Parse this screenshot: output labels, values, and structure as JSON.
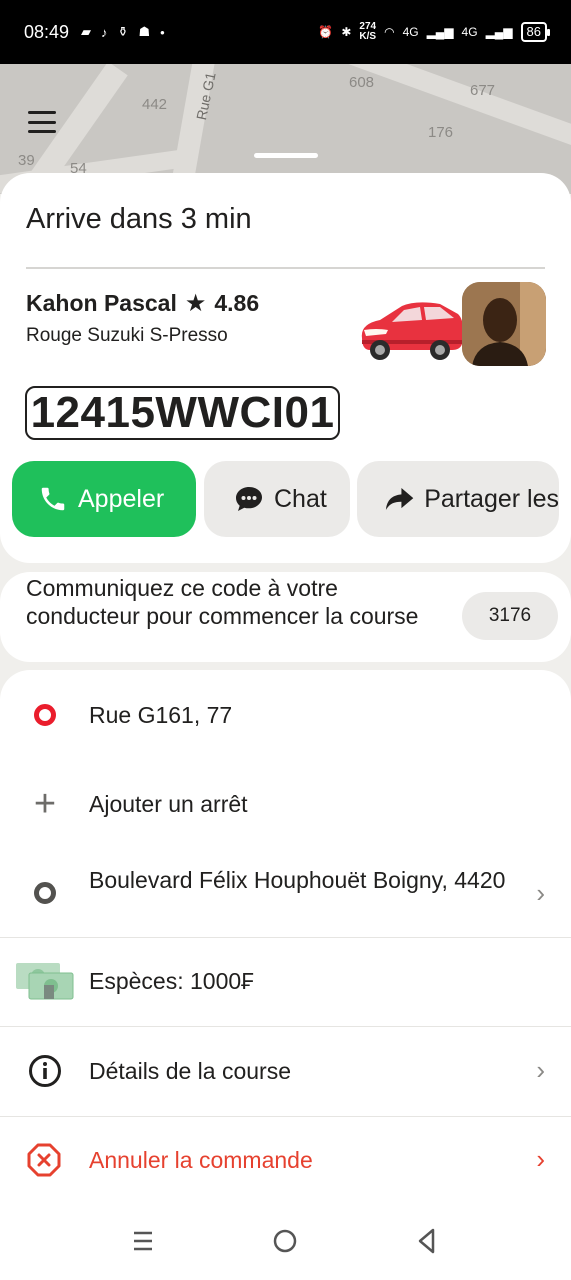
{
  "status_bar": {
    "time": "08:49",
    "net_speed_value": "274",
    "net_speed_unit": "K/S",
    "network_1": "4G",
    "network_2": "4G",
    "battery": "86"
  },
  "map": {
    "road_label": "Rue G1",
    "house_numbers": [
      "442",
      "608",
      "677",
      "176",
      "39",
      "54"
    ]
  },
  "trip": {
    "arrival_status": "Arrive dans 3 min"
  },
  "driver": {
    "name": "Kahon Pascal",
    "rating": "4.86",
    "car_description": "Rouge Suzuki S-Presso",
    "plate": "12415WWCI01",
    "car_color": "#e8323f"
  },
  "actions": {
    "call_label": "Appeler",
    "chat_label": "Chat",
    "share_label": "Partager les",
    "call_color": "#1fc05b"
  },
  "pin": {
    "message": "Communiquez ce code à votre conducteur pour commencer la course",
    "code": "3176"
  },
  "route": {
    "pickup": "Rue G161, 77",
    "add_stop": "Ajouter un arrêt",
    "destination": "Boulevard Félix Houphouët Boigny, 4420",
    "payment": "Espèces: 1000₣",
    "details": "Détails de la course",
    "cancel": "Annuler la commande",
    "cancel_color": "#e6412f"
  },
  "icons": {
    "menu": "hamburger-menu-icon",
    "call": "phone-icon",
    "chat": "chat-bubble-icon",
    "share": "share-arrow-icon",
    "pickup": "pickup-point-icon",
    "add_stop": "plus-icon",
    "destination": "destination-point-icon",
    "payment": "cash-icon",
    "details": "info-icon",
    "cancel": "cancel-octagon-icon",
    "chevron": "chevron-right-icon"
  }
}
